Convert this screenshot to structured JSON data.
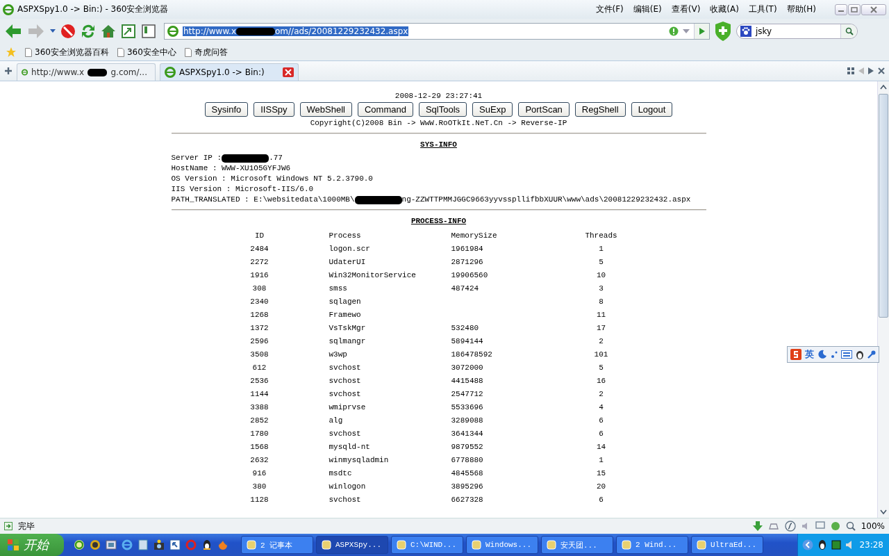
{
  "window": {
    "title": "ASPXSpy1.0 -> Bin:) - 360安全浏览器"
  },
  "menu": [
    "文件(F)",
    "编辑(E)",
    "查看(V)",
    "收藏(A)",
    "工具(T)",
    "帮助(H)"
  ],
  "address": {
    "text": "http://www.x",
    "redacted": true,
    "tail": "om//ads/20081229232432.aspx"
  },
  "search": {
    "value": "jsky"
  },
  "bookmarks": [
    "360安全浏览器百科",
    "360安全中心",
    "奇虎问答"
  ],
  "tabs": [
    {
      "text": "http://www.x",
      "redacted": true,
      "tail": "g.com/...",
      "selected": false
    },
    {
      "text": "ASPXSpy1.0 -> Bin:)",
      "redacted": false,
      "selected": true
    }
  ],
  "page": {
    "timestamp": "2008-12-29 23:27:41",
    "buttons": [
      "Sysinfo",
      "IISSpy",
      "WebShell",
      "Command",
      "SqlTools",
      "SuExp",
      "PortScan",
      "RegShell",
      "Logout"
    ],
    "copyright": "Copyright(C)2008 Bin -> WwW.RoOTkIt.NeT.Cn -> Reverse-IP",
    "sys_title": "SYS-INFO",
    "sys_info": [
      {
        "text": "Server IP : ",
        "redacted": true,
        "tail": ".77"
      },
      {
        "text": "HostName : WWW-XU1O5GYFJW6",
        "redacted": false
      },
      {
        "text": "OS Version : Microsoft Windows NT 5.2.3790.0",
        "redacted": false
      },
      {
        "text": "IIS Version : Microsoft-IIS/6.0",
        "redacted": false
      },
      {
        "text": "PATH_TRANSLATED : E:\\websitedata\\1000MB\\",
        "redacted": true,
        "tail": "ng-ZZWTTPMMJGGC9663yyvsspllifbbXUUR\\www\\ads\\20081229232432.aspx"
      }
    ],
    "process_title": "PROCESS-INFO",
    "columns": [
      "ID",
      "Process",
      "MemorySize",
      "Threads"
    ],
    "rows": [
      [
        "2484",
        "logon.scr",
        "1961984",
        "1"
      ],
      [
        "2272",
        "UdaterUI",
        "2871296",
        "5"
      ],
      [
        "1916",
        "Win32MonitorService",
        "19906560",
        "10"
      ],
      [
        "308",
        "smss",
        "487424",
        "3"
      ],
      [
        "2340",
        "sqlagen",
        "",
        "8"
      ],
      [
        "1268",
        "Framewo",
        "",
        "11"
      ],
      [
        "1372",
        "VsTskMgr",
        "532480",
        "17"
      ],
      [
        "2596",
        "sqlmangr",
        "5894144",
        "2"
      ],
      [
        "3508",
        "w3wp",
        "186478592",
        "101"
      ],
      [
        "612",
        "svchost",
        "3072000",
        "5"
      ],
      [
        "2536",
        "svchost",
        "4415488",
        "16"
      ],
      [
        "1144",
        "svchost",
        "2547712",
        "2"
      ],
      [
        "3388",
        "wmiprvse",
        "5533696",
        "4"
      ],
      [
        "2852",
        "alg",
        "3289088",
        "6"
      ],
      [
        "1780",
        "svchost",
        "3641344",
        "6"
      ],
      [
        "1568",
        "mysqld-nt",
        "9879552",
        "14"
      ],
      [
        "2632",
        "winmysqladmin",
        "6778880",
        "1"
      ],
      [
        "916",
        "msdtc",
        "4845568",
        "15"
      ],
      [
        "380",
        "winlogon",
        "3895296",
        "20"
      ],
      [
        "1128",
        "svchost",
        "6627328",
        "6"
      ]
    ]
  },
  "ime_bar": {
    "mode": "英"
  },
  "status_bar": {
    "text": "完毕",
    "zoom": "100%"
  },
  "taskbar": {
    "start": "开始",
    "items": [
      {
        "text": "2 记事本",
        "selected": false
      },
      {
        "text": "ASPXSpy...",
        "selected": true
      },
      {
        "text": "C:\\WIND...",
        "selected": false
      },
      {
        "text": "Windows...",
        "selected": false
      },
      {
        "text": "安天团...",
        "selected": false
      },
      {
        "text": "2 Wind...",
        "selected": false
      },
      {
        "text": "UltraEd...",
        "selected": false
      }
    ],
    "clock": "23:28"
  }
}
